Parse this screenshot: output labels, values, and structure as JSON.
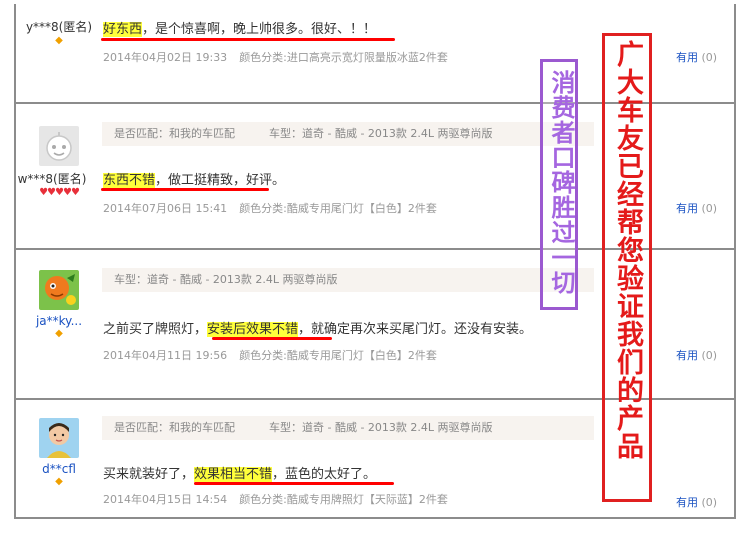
{
  "reviews": [
    {
      "user_name": "y***8(匿名)",
      "avatar": "none",
      "parts": [
        "好东西",
        "，是个惊喜啊，晚上帅很多。很好、！！"
      ],
      "date": "2014年04月02日 19:33",
      "spec": "颜色分类:进口高亮示宽灯限量版冰蓝2件套",
      "useful_label": "有用",
      "useful_count": "(0)"
    },
    {
      "user_name": "w***8(匿名)",
      "avatar": "robot-placeholder",
      "match": "是否匹配：和我的车匹配",
      "model": "车型：道奇 - 酷威 - 2013款 2.4L 两驱尊尚版",
      "parts": [
        "东西不错",
        "，做工挺精致，好评。"
      ],
      "date": "2014年07月06日 15:41",
      "spec": "颜色分类:酷威专用尾门灯【白色】2件套",
      "useful_label": "有用",
      "useful_count": "(0)"
    },
    {
      "user_name": "ja**ky...",
      "avatar": "orange-cartoon",
      "model": "车型：道奇 - 酷威 - 2013款 2.4L 两驱尊尚版",
      "parts": [
        "之前买了牌照灯，",
        "安装后效果不错",
        "，就确定再次来买尾门灯。还没有安装。"
      ],
      "date": "2014年04月11日 19:56",
      "spec": "颜色分类:酷威专用尾门灯【白色】2件套",
      "useful_label": "有用",
      "useful_count": "(0)"
    },
    {
      "user_name": "d**cfl",
      "avatar": "child-photo",
      "match": "是否匹配：和我的车匹配",
      "model": "车型：道奇 - 酷威 - 2013款 2.4L 两驱尊尚版",
      "parts": [
        "买来就装好了，",
        "效果相当不错",
        "，蓝色的太好了。"
      ],
      "date": "2014年04月15日 14:54",
      "spec": "颜色分类:酷威专用牌照灯【天际蓝】2件套",
      "useful_label": "有用",
      "useful_count": "(0)"
    }
  ],
  "annotations": {
    "purple_text": "消费者口碑胜过一切",
    "red_text": "广大车友已经帮您验证我们的产品"
  },
  "colors": {
    "highlight": "#ffff3b",
    "underline": "#ff0000",
    "purple": "#a566e0",
    "red": "#e41a1a",
    "useful_link": "#1a52c2"
  }
}
